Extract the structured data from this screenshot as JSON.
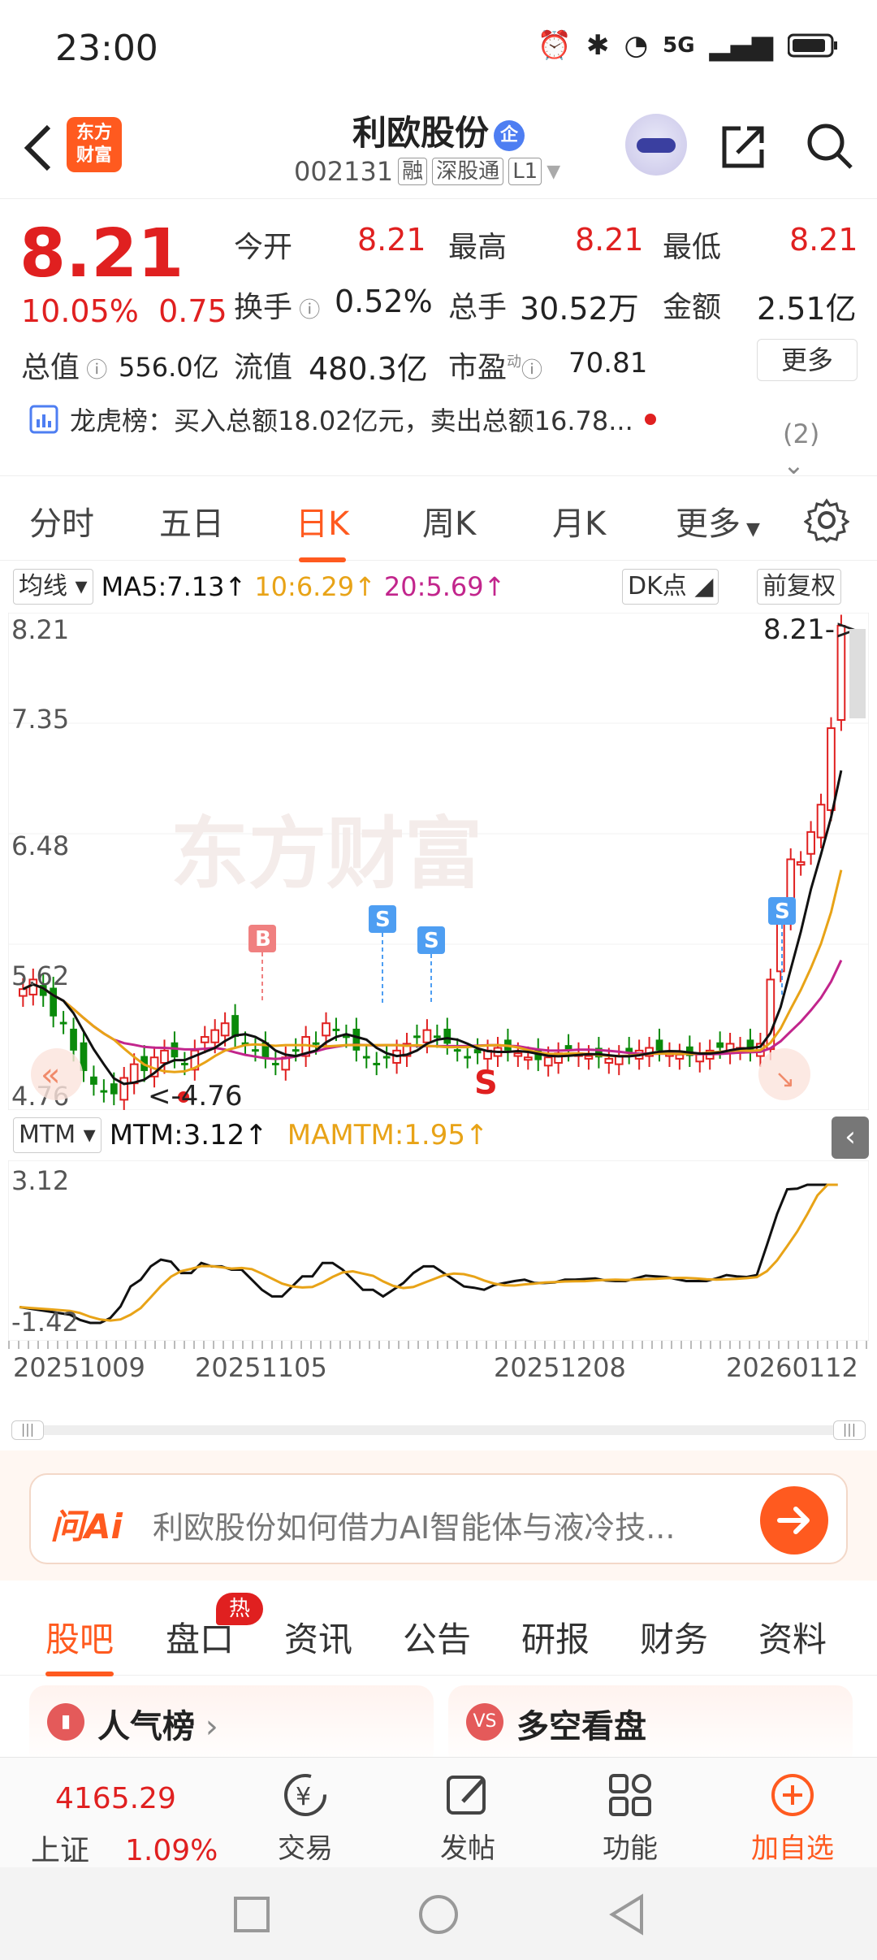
{
  "status_bar": {
    "time": "23:00",
    "network": "5G"
  },
  "header": {
    "logo_text": "东方财富",
    "stock_name": "利欧股份",
    "badge": "企",
    "stock_code": "002131",
    "tags": [
      "融",
      "深股通",
      "L1"
    ]
  },
  "quote": {
    "price": "8.21",
    "change_pct": "10.05%",
    "change_amt": "0.75",
    "open_label": "今开",
    "open": "8.21",
    "high_label": "最高",
    "high": "8.21",
    "low_label": "最低",
    "low": "8.21",
    "turnover_label": "换手",
    "turnover": "0.52%",
    "volume_label": "总手",
    "volume": "30.52万",
    "amount_label": "金额",
    "amount": "2.51亿",
    "mktcap_label": "总值",
    "mktcap": "556.0亿",
    "float_label": "流值",
    "float": "480.3亿",
    "pe_label": "市盈",
    "pe_sup": "动",
    "pe": "70.81",
    "more": "更多",
    "lhb_text": "龙虎榜：买入总额18.02亿元，卖出总额16.78...",
    "lhb_count": "(2)"
  },
  "period_tabs": [
    "分时",
    "五日",
    "日K",
    "周K",
    "月K",
    "更多"
  ],
  "active_period": "日K",
  "ma_bar": {
    "selector": "均线",
    "ma5": "MA5:7.13↑",
    "ma10": "10:6.29↑",
    "ma20": "20:5.69↑",
    "dk": "DK点",
    "adjust": "前复权"
  },
  "kchart_labels": {
    "y_ticks": [
      "8.21",
      "7.35",
      "6.48",
      "5.62",
      "4.76"
    ],
    "max_label": "8.21->",
    "min_label": "<-4.76",
    "watermark": "东方财富",
    "signals": [
      "B",
      "S",
      "S",
      "S"
    ],
    "s_mark": "S"
  },
  "mtm_bar": {
    "selector": "MTM",
    "mtm": "MTM:3.12↑",
    "mamtm": "MAMTM:1.95↑",
    "y_max": "3.12",
    "y_min": "-1.42"
  },
  "x_axis": [
    "20251009",
    "20251105",
    "20251208",
    "20260112"
  ],
  "ai_bar": {
    "logo": "问Ai",
    "prompt": "利欧股份如何借力AI智能体与液冷技..."
  },
  "community_tabs": [
    "股吧",
    "盘口",
    "资讯",
    "公告",
    "研报",
    "财务",
    "资料"
  ],
  "hot_badge": "热",
  "cards": [
    {
      "title": "人气榜",
      "icon": "chart-icon"
    },
    {
      "title": "多空看盘",
      "icon": "vs-icon",
      "icon_text": "VS"
    }
  ],
  "bottom_nav": {
    "index_value": "4165.29",
    "index_name": "上证",
    "index_change": "1.09%",
    "items": [
      "交易",
      "发帖",
      "功能",
      "加自选"
    ]
  },
  "colors": {
    "up": "#e02020",
    "down": "#0a8a0a",
    "accent": "#ff5a1f",
    "ma5": "#111111",
    "ma10": "#e8a317",
    "ma20": "#c2258c"
  },
  "chart_data": {
    "type": "candlestick",
    "x": [
      "20251009",
      "20251105",
      "20251208",
      "20260112"
    ],
    "ylim": [
      4.76,
      8.21
    ],
    "recent_closes": [
      5.1,
      5.62,
      6.1,
      6.9,
      7.46,
      8.21
    ],
    "high": 8.21,
    "low": 4.76,
    "ma5": 7.13,
    "ma10": 6.29,
    "ma20": 5.69,
    "mtm": 3.12,
    "mamtm": 1.95,
    "mtm_range": [
      -1.42,
      3.12
    ]
  }
}
